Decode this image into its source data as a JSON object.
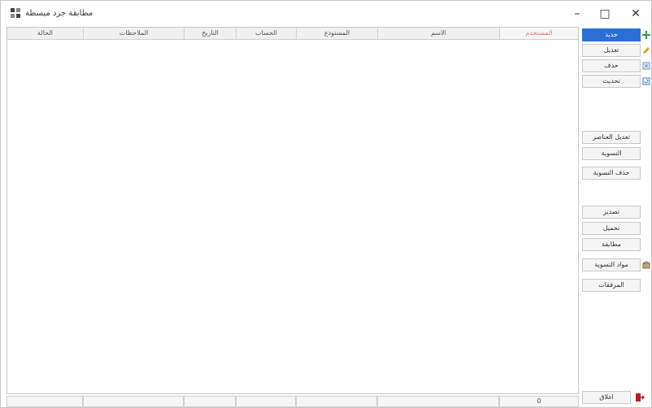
{
  "window": {
    "title": "مطابقة جرد مبسطة",
    "minimize": "–",
    "maximize": "□",
    "close": "✕"
  },
  "table": {
    "columns": [
      "الحالة",
      "الملاحظات",
      "التاريخ",
      "الحساب",
      "المستودع",
      "الاسم",
      "المستخدم"
    ]
  },
  "sidebar": {
    "buttons": [
      {
        "label": "جديد",
        "icon": "plus-icon"
      },
      {
        "label": "تعديل",
        "icon": "edit-icon"
      },
      {
        "label": "حذف",
        "icon": "delete-icon"
      },
      {
        "label": "تحديث",
        "icon": "refresh-icon"
      },
      {
        "label": "تعديل العناصر"
      },
      {
        "label": "التسوية"
      },
      {
        "label": "حذف التسوية"
      },
      {
        "label": "تصدير"
      },
      {
        "label": "تحميل"
      },
      {
        "label": "مطابقة"
      },
      {
        "label": "مواد التسوية",
        "icon": "box-icon"
      },
      {
        "label": "المرفقات"
      }
    ]
  },
  "status": {
    "count": "0"
  },
  "footer": {
    "close_label": "اغلاق"
  },
  "colors": {
    "accent": "#2a6fd6",
    "selected_header_text": "#e07a6a"
  }
}
